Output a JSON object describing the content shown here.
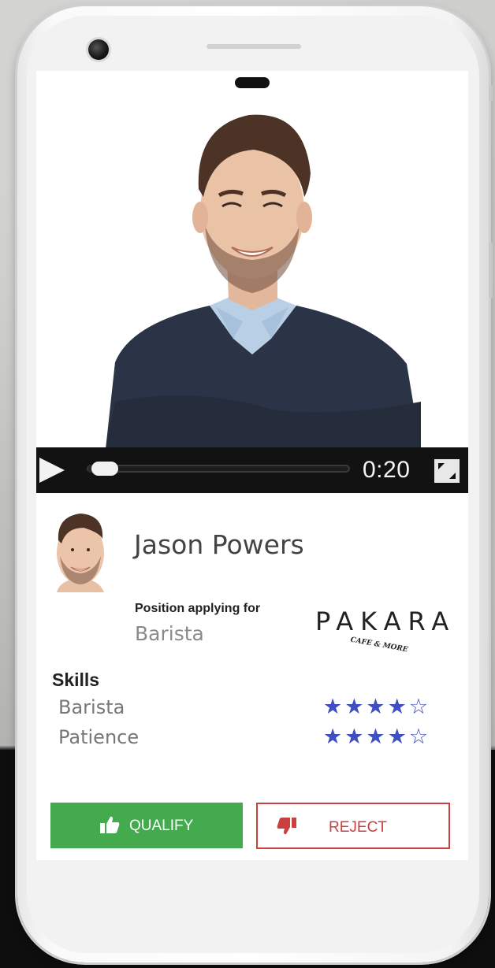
{
  "video": {
    "time": "0:20",
    "progress": 0.02
  },
  "candidate": {
    "name": "Jason Powers",
    "position_label": "Position applying for",
    "position_value": "Barista"
  },
  "company": {
    "logo_name": "PAKARA",
    "logo_tagline": "CAFE & MORE"
  },
  "skills": {
    "title": "Skills",
    "items": [
      {
        "name": "Barista",
        "stars": "★★★★",
        "empty": "☆",
        "rating": 4,
        "max": 5
      },
      {
        "name": "Patience",
        "stars": "★★★★",
        "empty": "☆",
        "rating": 4,
        "max": 5
      }
    ]
  },
  "actions": {
    "qualify_label": "QUALIFY",
    "reject_label": "REJECT"
  },
  "colors": {
    "accent_green": "#44aa4e",
    "accent_red": "#c9403f",
    "star_blue": "#3f4ec0"
  }
}
